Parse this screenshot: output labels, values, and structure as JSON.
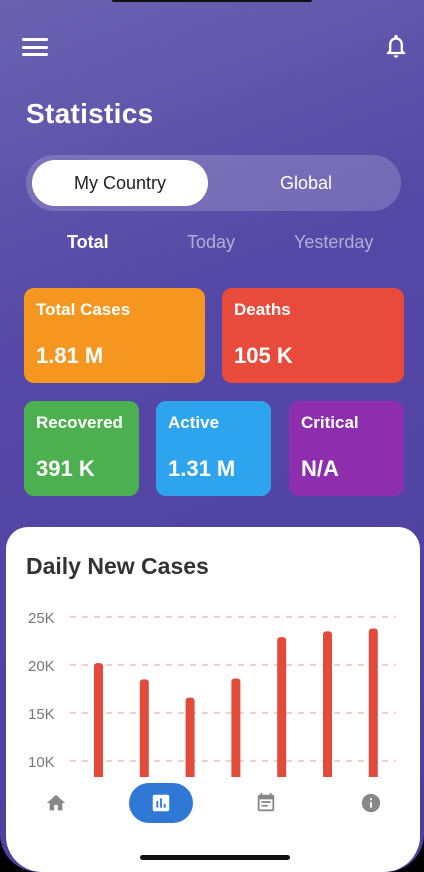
{
  "header": {
    "title": "Statistics",
    "menu_icon": "menu-icon",
    "bell_icon": "bell-icon"
  },
  "segment": {
    "options": [
      "My Country",
      "Global"
    ],
    "selected": "My Country"
  },
  "periods": {
    "options": [
      "Total",
      "Today",
      "Yesterday"
    ],
    "selected": "Total"
  },
  "cards": [
    {
      "label": "Total Cases",
      "value": "1.81 M",
      "color": "#f4961f"
    },
    {
      "label": "Deaths",
      "value": "105 K",
      "color": "#e84b3c"
    },
    {
      "label": "Recovered",
      "value": "391 K",
      "color": "#4caf50"
    },
    {
      "label": "Active",
      "value": "1.31 M",
      "color": "#2fa4ee"
    },
    {
      "label": "Critical",
      "value": "N/A",
      "color": "#8e2eae"
    }
  ],
  "daily": {
    "title": "Daily New Cases"
  },
  "chart_data": {
    "type": "bar",
    "title": "Daily New Cases",
    "xlabel": "",
    "ylabel": "",
    "yticks": [
      "25K",
      "20K",
      "15K",
      "10K"
    ],
    "ylim": [
      10000,
      25000
    ],
    "values": [
      20200,
      18500,
      16600,
      18600,
      22900,
      23500,
      23800
    ],
    "bar_color": "#e24a3a",
    "grid": true
  },
  "nav": {
    "items": [
      {
        "icon": "home-icon",
        "active": false
      },
      {
        "icon": "bar-chart-icon",
        "active": true
      },
      {
        "icon": "calendar-icon",
        "active": false
      },
      {
        "icon": "info-icon",
        "active": false
      }
    ],
    "active_color": "#2f78d6",
    "icon_color": "#888888"
  }
}
